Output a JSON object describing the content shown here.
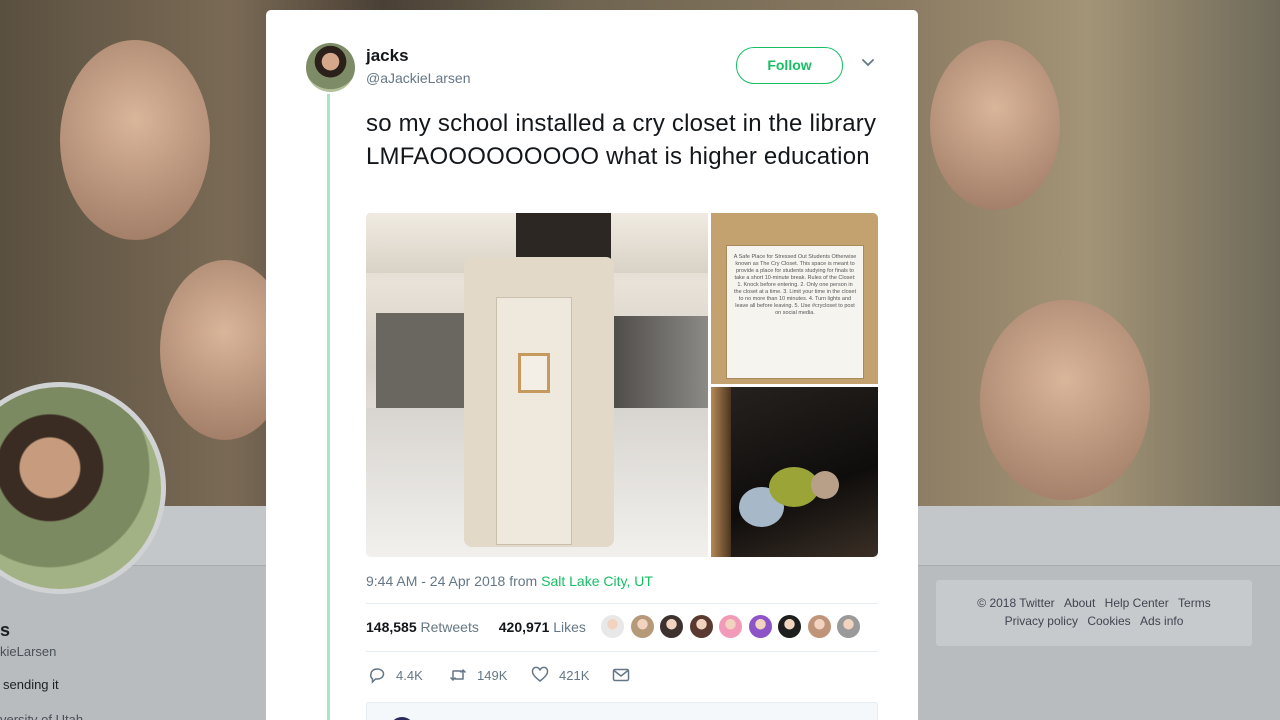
{
  "background": {
    "profile_name_partial": "s",
    "profile_handle_partial": "kieLarsen",
    "profile_bio_partial": "sending it",
    "profile_bio_line2_partial": "versity of Utah",
    "footer_links": [
      "© 2018 Twitter",
      "About",
      "Help Center",
      "Terms",
      "Privacy policy",
      "Cookies",
      "Ads info"
    ]
  },
  "tweet": {
    "author_name": "jacks",
    "author_handle": "@aJackieLarsen",
    "follow_label": "Follow",
    "text": "so my school installed a cry closet in the library LMFAOOOOOOOOO what is higher education",
    "sign_text": "A Safe Place for Stressed Out Students Otherwise known as The Cry Closet. This space is meant to provide a place for students studying for finals to take a short 10-minute break. Rules of the Closet: 1. Knock before entering. 2. Only one person in the closet at a time. 3. Limit your time in the closet to no more than 10 minutes. 4. Turn lights and leave all before leaving. 5. Use #crycloset to post on social media.",
    "timestamp": "9:44 AM - 24 Apr 2018",
    "from_label": "from",
    "location": "Salt Lake City, UT",
    "retweets_count": "148,585",
    "retweets_label": "Retweets",
    "likes_count": "420,971",
    "likes_label": "Likes",
    "liker_colors": [
      "#e8e8e8",
      "#b59a7a",
      "#3d3230",
      "#5a3a30",
      "#f29ab8",
      "#8d54c7",
      "#1e1e1e",
      "#c09478",
      "#9a9a9a"
    ],
    "actions": {
      "reply_count": "4.4K",
      "retweet_count": "149K",
      "like_count": "421K"
    }
  },
  "colors": {
    "accent_green": "#17bf63",
    "thread_line": "#a6e6c9",
    "muted_text": "#657786"
  }
}
